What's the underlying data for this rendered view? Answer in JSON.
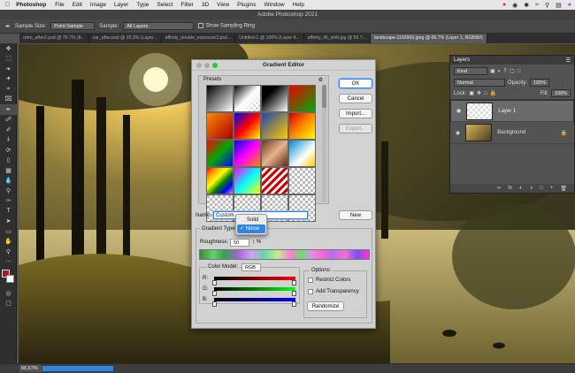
{
  "menubar": {
    "apple": "",
    "app": "Photoshop",
    "items": [
      "File",
      "Edit",
      "Image",
      "Layer",
      "Type",
      "Select",
      "Filter",
      "3D",
      "View",
      "Plugins",
      "Window",
      "Help"
    ],
    "right_time": ""
  },
  "titlebar": {
    "title": "Adobe Photoshop 2021"
  },
  "options": {
    "sample_size_label": "Sample Size:",
    "sample_size_value": "Point Sample",
    "sample_label": "Sample:",
    "sample_value": "All Layers",
    "ring_label": "Show Sampling Ring"
  },
  "tabs": [
    "retro_after2.psd @ 76.7% (lt...",
    "car_after.psd @ 33.3% (Layer...",
    "affinity_double_exposure2.psd...",
    "Untitled-1 @ 100% (Layer 4...",
    "affinity_tilt_shift.jpg @ 56.7...",
    "landscape-1192669.jpeg @ 66.7% (Layer 1, RGB/8#)"
  ],
  "status": {
    "zoom": "66.67%"
  },
  "layers": {
    "title": "Layers",
    "kind": "Kind",
    "blend": "Normal",
    "opacity_label": "Opacity:",
    "opacity": "100%",
    "lock_label": "Lock:",
    "fill_label": "Fill:",
    "fill": "100%",
    "items": [
      {
        "name": "Layer 1"
      },
      {
        "name": "Background"
      }
    ]
  },
  "gradient_editor": {
    "title": "Gradient Editor",
    "presets_label": "Presets",
    "buttons": {
      "ok": "OK",
      "cancel": "Cancel",
      "import": "Import...",
      "export": "Export...",
      "new": "New"
    },
    "name_label": "Name:",
    "name_value": "Custom",
    "type_label": "Gradient Type:",
    "type_options": [
      "Solid",
      "Noise"
    ],
    "type_selected": "Noise",
    "roughness_label": "Roughness:",
    "roughness_value": "50",
    "roughness_unit": "%",
    "color_model_label": "Color Model:",
    "color_model_value": "RGB",
    "channels": [
      "R:",
      "G:",
      "B:"
    ],
    "options_label": "Options:",
    "restrict": "Restrict Colors",
    "transparency": "Add Transparency",
    "randomize": "Randomize"
  },
  "colors": {
    "accent": "#3383e0"
  }
}
